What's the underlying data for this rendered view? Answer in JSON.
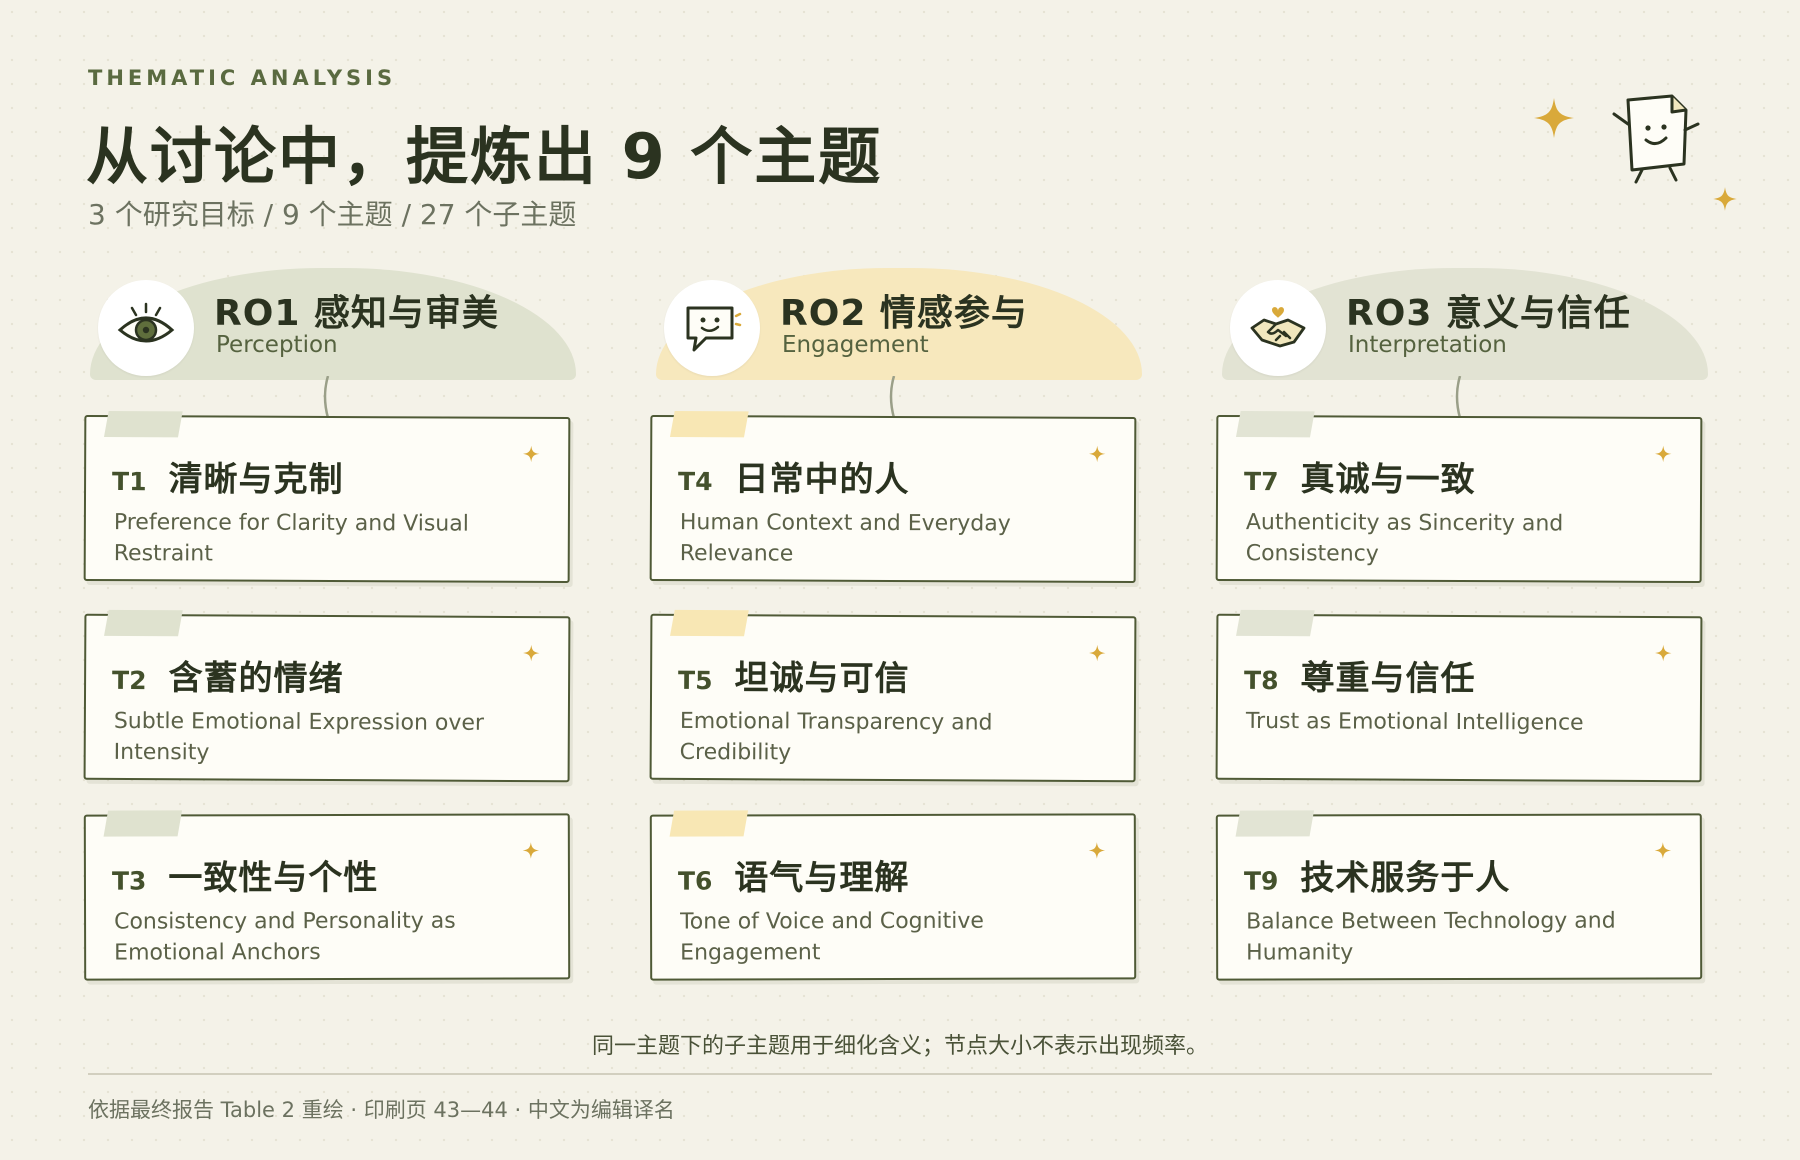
{
  "header": {
    "eyebrow": "THEMATIC ANALYSIS",
    "title": "从讨论中，提炼出 9 个主题",
    "subtitle": "3 个研究目标 / 9 个主题 / 27 个子主题"
  },
  "objectives": [
    {
      "title": "RO1 感知与审美",
      "subtitle": "Perception",
      "icon": "eye-icon",
      "color": "#dfe2cf",
      "tape": "#dfe2cf",
      "themes": [
        {
          "code": "T1",
          "title": "清晰与克制",
          "desc": "Preference for Clarity and Visual Restraint"
        },
        {
          "code": "T2",
          "title": "含蓄的情绪",
          "desc": "Subtle Emotional Expression over Intensity"
        },
        {
          "code": "T3",
          "title": "一致性与个性",
          "desc": "Consistency and Personality as Emotional Anchors"
        }
      ]
    },
    {
      "title": "RO2 情感参与",
      "subtitle": "Engagement",
      "icon": "chat-bubble-icon",
      "color": "#f7e8bd",
      "tape": "#f8e7b4",
      "themes": [
        {
          "code": "T4",
          "title": "日常中的人",
          "desc": "Human Context and Everyday Relevance"
        },
        {
          "code": "T5",
          "title": "坦诚与可信",
          "desc": "Emotional Transparency and Credibility"
        },
        {
          "code": "T6",
          "title": "语气与理解",
          "desc": "Tone of Voice and Cognitive Engagement"
        }
      ]
    },
    {
      "title": "RO3 意义与信任",
      "subtitle": "Interpretation",
      "icon": "handshake-icon",
      "color": "#e2e3d3",
      "tape": "#e2e4d4",
      "themes": [
        {
          "code": "T7",
          "title": "真诚与一致",
          "desc": "Authenticity as Sincerity and Consistency"
        },
        {
          "code": "T8",
          "title": "尊重与信任",
          "desc": "Trust as Emotional Intelligence"
        },
        {
          "code": "T9",
          "title": "技术服务于人",
          "desc": "Balance Between Technology and Humanity"
        }
      ]
    }
  ],
  "note": "同一主题下的子主题用于细化含义；节点大小不表示出现频率。",
  "footer": "依据最终报告 Table 2 重绘 · 印刷页 43—44 · 中文为编辑译名",
  "colors": {
    "accent_gold": "#d9a93a",
    "ink": "#2b3320",
    "card_border": "#4f5a36"
  }
}
